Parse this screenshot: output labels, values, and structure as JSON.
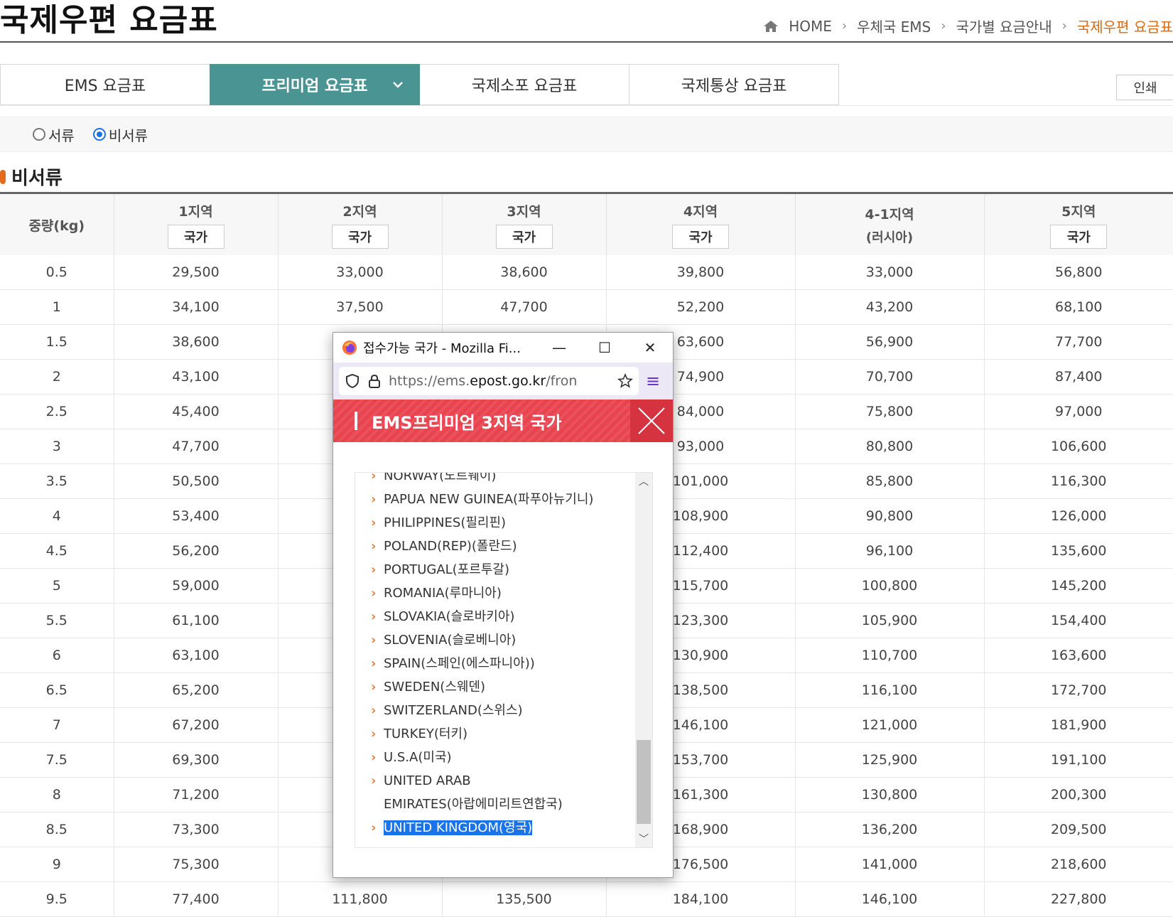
{
  "page": {
    "title": "국제우편 요금표",
    "breadcrumb": [
      "HOME",
      "우체국 EMS",
      "국가별 요금안내",
      "국제우편 요금표"
    ]
  },
  "tabs": [
    {
      "label": "EMS 요금표",
      "active": false
    },
    {
      "label": "프리미엄 요금표",
      "active": true
    },
    {
      "label": "국제소포 요금표",
      "active": false
    },
    {
      "label": "국제통상 요금표",
      "active": false
    }
  ],
  "print_label": "인쇄",
  "radios": [
    {
      "label": "서류",
      "checked": false
    },
    {
      "label": "비서류",
      "checked": true
    }
  ],
  "section_title": "비서류",
  "table": {
    "weight_header": "중량(kg)",
    "columns": [
      {
        "zone": "1지역",
        "sub": "국가",
        "is_button": true
      },
      {
        "zone": "2지역",
        "sub": "국가",
        "is_button": true
      },
      {
        "zone": "3지역",
        "sub": "국가",
        "is_button": true
      },
      {
        "zone": "4지역",
        "sub": "국가",
        "is_button": true
      },
      {
        "zone": "4-1지역",
        "sub": "(러시아)",
        "is_button": false
      },
      {
        "zone": "5지역",
        "sub": "국가",
        "is_button": true
      }
    ],
    "rows": [
      [
        "0.5",
        "29,500",
        "33,000",
        "38,600",
        "39,800",
        "33,000",
        "56,800"
      ],
      [
        "1",
        "34,100",
        "37,500",
        "47,700",
        "52,200",
        "43,200",
        "68,100"
      ],
      [
        "1.5",
        "38,600",
        "",
        "",
        "63,600",
        "56,900",
        "77,700"
      ],
      [
        "2",
        "43,100",
        "",
        "",
        "74,900",
        "70,700",
        "87,400"
      ],
      [
        "2.5",
        "45,400",
        "",
        "",
        "84,000",
        "75,800",
        "97,000"
      ],
      [
        "3",
        "47,700",
        "",
        "",
        "93,000",
        "80,800",
        "106,600"
      ],
      [
        "3.5",
        "50,500",
        "",
        "",
        "101,000",
        "85,800",
        "116,300"
      ],
      [
        "4",
        "53,400",
        "",
        "",
        "108,900",
        "90,800",
        "126,000"
      ],
      [
        "4.5",
        "56,200",
        "",
        "",
        "112,400",
        "96,100",
        "135,600"
      ],
      [
        "5",
        "59,000",
        "",
        "",
        "115,700",
        "100,800",
        "145,200"
      ],
      [
        "5.5",
        "61,100",
        "",
        "",
        "123,300",
        "105,900",
        "154,400"
      ],
      [
        "6",
        "63,100",
        "",
        "",
        "130,900",
        "110,700",
        "163,600"
      ],
      [
        "6.5",
        "65,200",
        "",
        "",
        "138,500",
        "116,100",
        "172,700"
      ],
      [
        "7",
        "67,200",
        "",
        "",
        "146,100",
        "121,000",
        "181,900"
      ],
      [
        "7.5",
        "69,300",
        "",
        "",
        "153,700",
        "125,900",
        "191,100"
      ],
      [
        "8",
        "71,200",
        "",
        "",
        "161,300",
        "130,800",
        "200,300"
      ],
      [
        "8.5",
        "73,300",
        "",
        "",
        "168,900",
        "136,200",
        "209,500"
      ],
      [
        "9",
        "75,300",
        "",
        "",
        "176,500",
        "141,000",
        "218,600"
      ],
      [
        "9.5",
        "77,400",
        "111,800",
        "135,500",
        "184,100",
        "146,100",
        "227,800"
      ]
    ]
  },
  "popup": {
    "window_title": "접수가능 국가 - Mozilla Fi...",
    "url_prefix": "https://ems.",
    "url_domain": "epost.go.kr",
    "url_suffix": "/fron",
    "header": "EMS프리미엄 3지역 국가",
    "countries": [
      {
        "text": "NORWAY(노르웨이)",
        "cont": false,
        "sel": false
      },
      {
        "text": "PAPUA NEW GUINEA(파푸아뉴기니)",
        "cont": false,
        "sel": false
      },
      {
        "text": "PHILIPPINES(필리핀)",
        "cont": false,
        "sel": false
      },
      {
        "text": "POLAND(REP)(폴란드)",
        "cont": false,
        "sel": false
      },
      {
        "text": "PORTUGAL(포르투갈)",
        "cont": false,
        "sel": false
      },
      {
        "text": "ROMANIA(루마니아)",
        "cont": false,
        "sel": false
      },
      {
        "text": "SLOVAKIA(슬로바키아)",
        "cont": false,
        "sel": false
      },
      {
        "text": "SLOVENIA(슬로베니아)",
        "cont": false,
        "sel": false
      },
      {
        "text": "SPAIN(스페인(에스파니아))",
        "cont": false,
        "sel": false
      },
      {
        "text": "SWEDEN(스웨덴)",
        "cont": false,
        "sel": false
      },
      {
        "text": "SWITZERLAND(스위스)",
        "cont": false,
        "sel": false
      },
      {
        "text": "TURKEY(터키)",
        "cont": false,
        "sel": false
      },
      {
        "text": "U.S.A(미국)",
        "cont": false,
        "sel": false
      },
      {
        "text": "UNITED ARAB",
        "cont": false,
        "sel": false
      },
      {
        "text": "EMIRATES(아랍에미리트연합국)",
        "cont": true,
        "sel": false
      },
      {
        "text": "UNITED KINGDOM(영국)",
        "cont": false,
        "sel": true
      }
    ]
  },
  "colors": {
    "tab_active": "#4a9594",
    "accent_orange": "#d86a13",
    "popup_header": "#e84450",
    "selection": "#1a73e8"
  }
}
